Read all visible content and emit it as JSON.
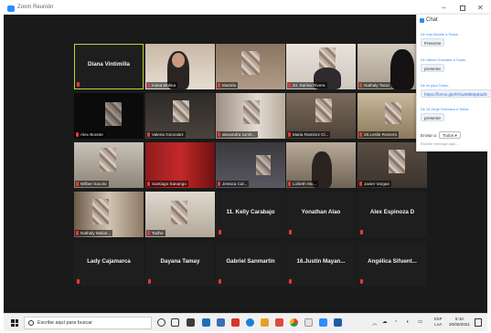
{
  "window": {
    "title": "Zoom Reunión",
    "minimize": "–",
    "close": "✕"
  },
  "gallery": {
    "highlighted_name": "Diana Vintimilla",
    "video_tiles": [
      "Ivana Molina",
      "Mariela",
      "24. Karina Rivera",
      "Nathaly Tacur",
      "Alex Bonete",
      "Valeria Gonzalez",
      "alexandra sumb...",
      "Maria Ramirez Cl...",
      "25.Leslie Romero",
      "Wilber Sacoto",
      "Santiago Sanango",
      "Jessica Cal...",
      "Lizbeth Mu...",
      "Javier Vargas",
      "Nathaly Malan...",
      "Tadhe"
    ],
    "name_tiles": [
      "11. Kelly Carabajo",
      "Yonathan Alao",
      "Alex Espinoza D",
      "Lady Cajamarca",
      "Dayana Tamay",
      "Gabriel Sanmartin",
      "16.Justin Mayan...",
      "Angélica Sifuent..."
    ]
  },
  "chat": {
    "title": "Chat",
    "messages": [
      {
        "from": "De Ivan Bonete a Todos:",
        "text": "Presente"
      },
      {
        "from": "De Valeria Gonzalez a Todos:",
        "text": "presente"
      },
      {
        "from": "De mí para Todos:",
        "text": "https://forms.gle/bTiaz89iMpBoZ5"
      },
      {
        "from": "De 16.Jorge Tenesaca a Todos:",
        "text": "presente"
      }
    ],
    "send_to_label": "Enviar a:",
    "send_to_value": "Todos ▾",
    "compose_placeholder": "Escribir mensaje aquí..."
  },
  "taskbar": {
    "search_placeholder": "Escribe aquí para buscar",
    "lang_top": "ESP",
    "lang_bottom": "LAA",
    "time": "8:10",
    "date": "20/05/2021"
  }
}
